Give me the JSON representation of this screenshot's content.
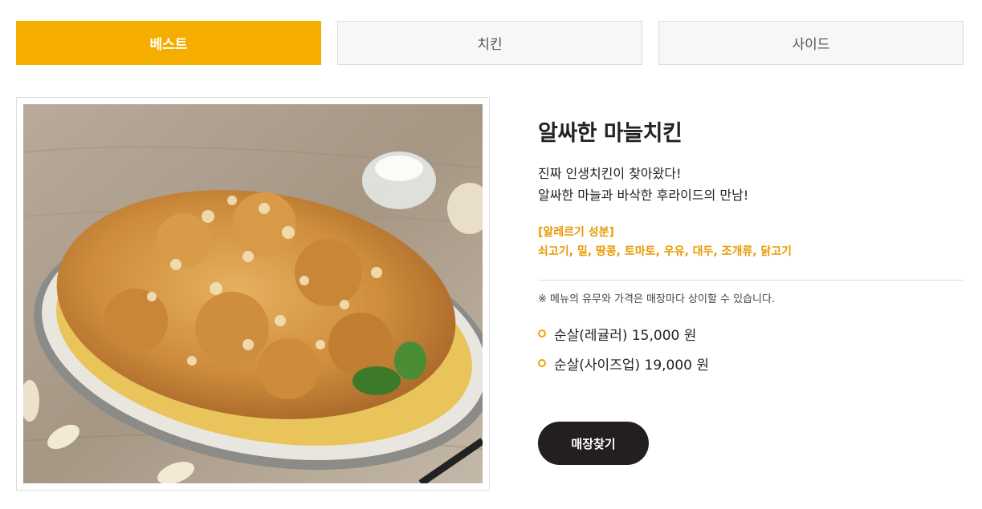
{
  "tabs": [
    {
      "label": "베스트",
      "active": true
    },
    {
      "label": "치킨",
      "active": false
    },
    {
      "label": "사이드",
      "active": false
    }
  ],
  "product": {
    "image_alt": "알싸한 마늘치킨",
    "name": "알싸한 마늘치킨",
    "description_line1": "진짜 인생치킨이 찾아왔다!",
    "description_line2": "알싸한 마늘과 바삭한 후라이드의 만남!",
    "allergy_title": "[알레르기 성분]",
    "allergy_list": "쇠고기, 밀, 땅콩, 토마토, 우유, 대두, 조개류, 닭고기",
    "notice": "※ 메뉴의 유무와 가격은 매장마다 상이할 수 있습니다.",
    "prices": [
      {
        "label": "순살(레귤러) 15,000 원"
      },
      {
        "label": "순살(사이즈업) 19,000 원"
      }
    ]
  },
  "buttons": {
    "find_store": "매장찾기"
  },
  "colors": {
    "accent": "#f5ad00",
    "allergy": "#e79a00",
    "button_dark": "#231f20"
  }
}
